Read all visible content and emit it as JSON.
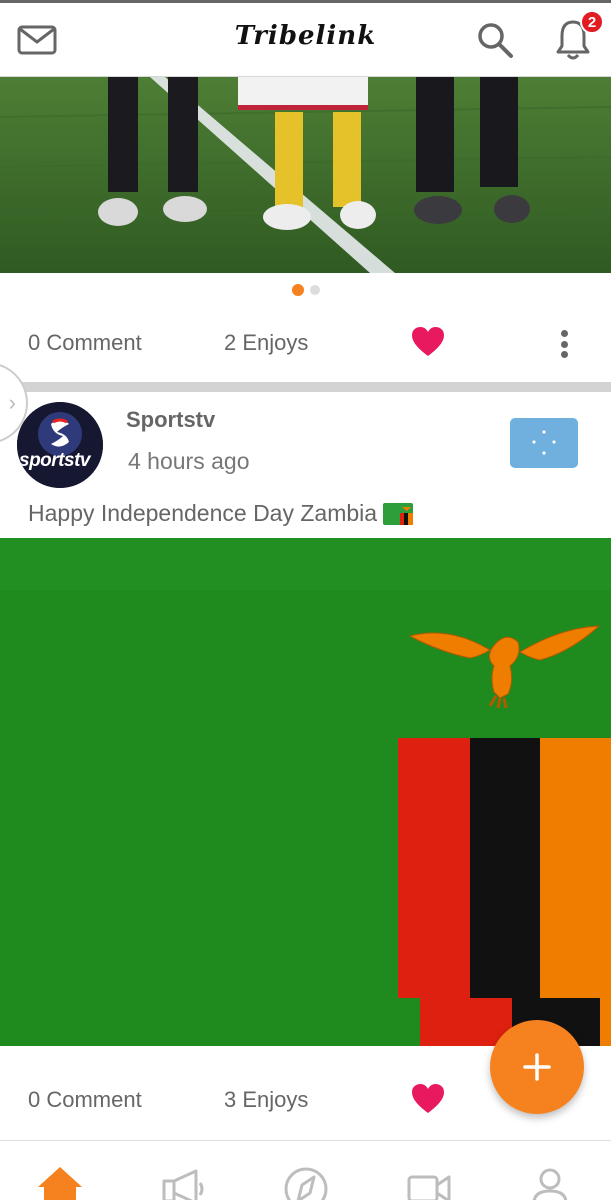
{
  "header": {
    "logo": "Tribelink",
    "notification_count": "2"
  },
  "feed": {
    "post1": {
      "comments": "0 Comment",
      "enjoys": "2 Enjoys",
      "carousel_pages": 2,
      "carousel_active": 1
    },
    "post2": {
      "author": "Sportstv",
      "time": "4 hours ago",
      "caption": "Happy Independence Day Zambia",
      "avatar_text": "sportstv",
      "comments": "0 Comment",
      "enjoys": "3 Enjoys"
    }
  },
  "bottom_nav": {
    "items": [
      {
        "icon": "home-icon",
        "active": true
      },
      {
        "icon": "megaphone-icon",
        "active": false
      },
      {
        "icon": "compass-icon",
        "active": false
      },
      {
        "icon": "video-icon",
        "active": false
      },
      {
        "icon": "profile-icon",
        "active": false
      }
    ]
  },
  "colors": {
    "accent": "#f5821f",
    "heart": "#e8195f",
    "badge": "#e31b23",
    "zambia_green": "#1f8b1f",
    "zambia_red": "#de2010",
    "zambia_orange": "#ef7d00"
  },
  "icons": {
    "mail": "mail-icon",
    "search": "search-icon",
    "bell": "bell-icon",
    "heart": "heart-icon",
    "more": "more-vertical-icon",
    "add": "plus-icon",
    "flag": "flag-icon"
  }
}
